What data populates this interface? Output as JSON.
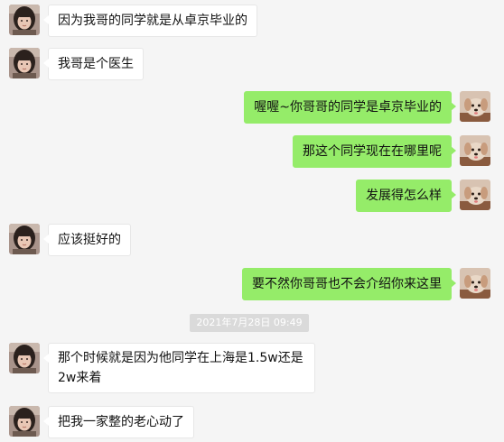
{
  "chat": {
    "colors": {
      "background": "#f5f5f5",
      "incoming_bubble": "#ffffff",
      "outgoing_bubble": "#95ec69",
      "timestamp_bg": "#dadada"
    },
    "contact_avatar_icon": "girl-avatar-icon",
    "self_avatar_icon": "dog-avatar-icon",
    "messages": [
      {
        "side": "left",
        "text": "因为我哥的同学就是从卓京毕业的"
      },
      {
        "side": "left",
        "text": "我哥是个医生"
      },
      {
        "side": "right",
        "text": "喔喔~你哥哥的同学是卓京毕业的"
      },
      {
        "side": "right",
        "text": "那这个同学现在在哪里呢"
      },
      {
        "side": "right",
        "text": "发展得怎么样"
      },
      {
        "side": "left",
        "text": "应该挺好的"
      },
      {
        "side": "right",
        "text": "要不然你哥哥也不会介绍你来这里"
      },
      {
        "side": "left",
        "text": "那个时候就是因为他同学在上海是1.5w还是2w来着"
      },
      {
        "side": "left",
        "text": "把我一家整的老心动了"
      }
    ],
    "timestamp": "2021年7月28日 09:49"
  }
}
